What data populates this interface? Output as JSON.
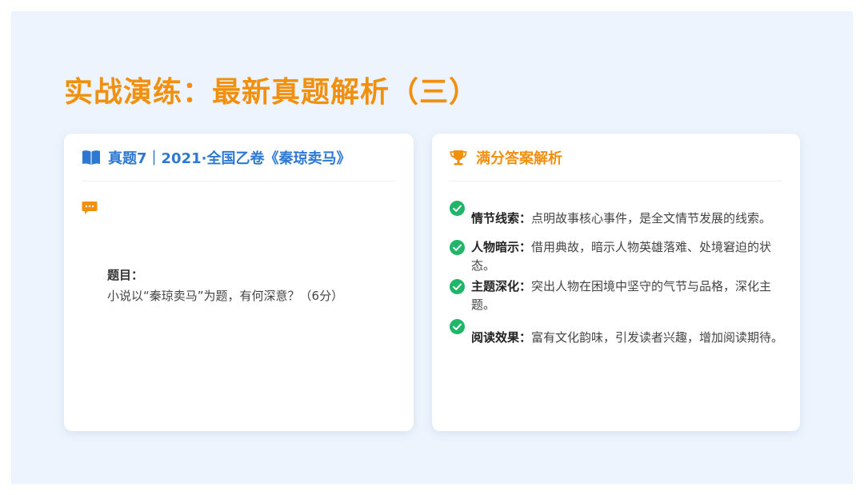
{
  "title": "实战演练：最新真题解析（三）",
  "colors": {
    "accent_orange": "#f0900e",
    "accent_blue": "#2f78d2",
    "check_green": "#21b56a",
    "background": "#edf4fd"
  },
  "left_card": {
    "icon": "book-icon",
    "heading": "真题7｜2021·全国乙卷《秦琼卖马》",
    "chat_icon": "chat-icon",
    "question_label": "题目：",
    "question_text": "小说以“秦琼卖马”为题，有何深意？（6分）"
  },
  "right_card": {
    "icon": "trophy-icon",
    "heading": "满分答案解析",
    "items": [
      {
        "key": "情节线索：",
        "text": "点明故事核心事件，是全文情节发展的线索。"
      },
      {
        "key": "人物暗示：",
        "text": "借用典故，暗示人物英雄落难、处境窘迫的状态。"
      },
      {
        "key": "主题深化：",
        "text": "突出人物在困境中坚守的气节与品格，深化主题。"
      },
      {
        "key": "阅读效果：",
        "text": "富有文化韵味，引发读者兴趣，增加阅读期待。"
      }
    ]
  }
}
